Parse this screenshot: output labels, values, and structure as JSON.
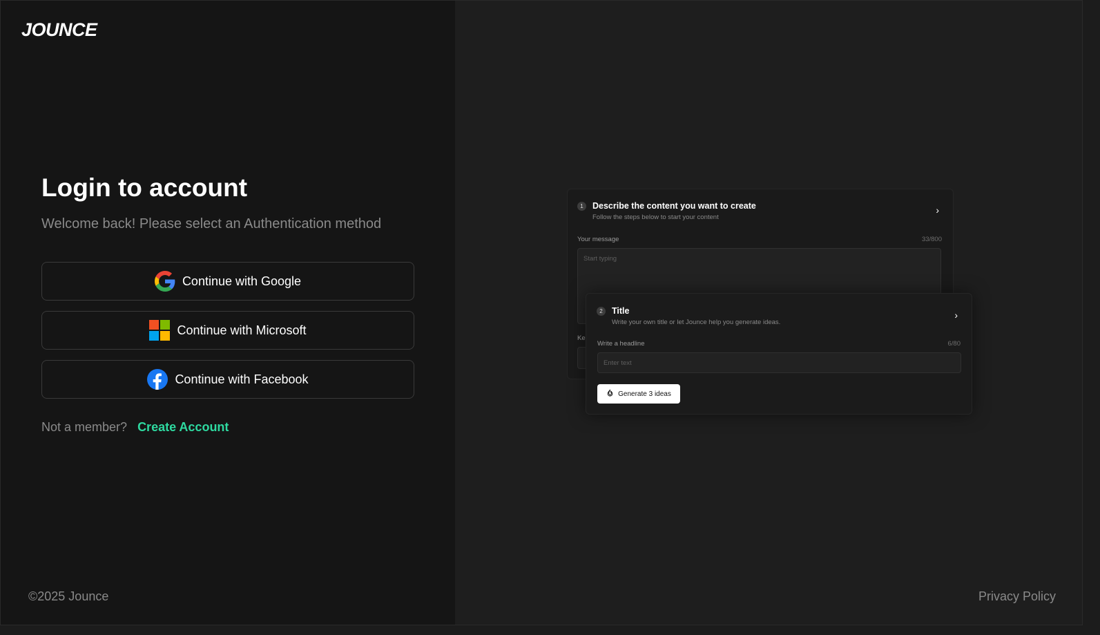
{
  "brand": {
    "logo_text": "JOUNCE"
  },
  "login": {
    "title": "Login to account",
    "subtitle": "Welcome back! Please select an Authentication method",
    "buttons": {
      "google": "Continue with Google",
      "microsoft": "Continue with Microsoft",
      "facebook": "Continue with Facebook"
    },
    "member_prompt": "Not a member?",
    "create_account": "Create Account"
  },
  "footer": {
    "copyright": "©2025 Jounce",
    "privacy": "Privacy Policy"
  },
  "preview": {
    "step1": {
      "number": "1",
      "title": "Describe the content you want to create",
      "subtitle": "Follow the steps below to start your content",
      "field_label": "Your message",
      "field_count": "33/800",
      "placeholder": "Start typing",
      "peek_label": "Ke"
    },
    "step2": {
      "number": "2",
      "title": "Title",
      "subtitle": "Write your own title or let Jounce help you generate ideas.",
      "field_label": "Write a headline",
      "field_count": "6/80",
      "placeholder": "Enter text",
      "generate_label": "Generate 3 ideas"
    }
  },
  "colors": {
    "accent": "#2ed9a0",
    "left_bg": "#151515",
    "right_bg": "#1e1e1e"
  }
}
